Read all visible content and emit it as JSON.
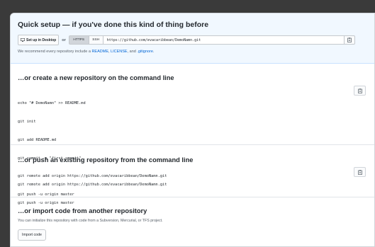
{
  "quick_setup": {
    "title": "Quick setup — if you've done this kind of thing before",
    "desktop_button": "Set up in Desktop",
    "or_label": "or",
    "https_label": "HTTPS",
    "ssh_label": "SSH",
    "clone_url": "https://github.com/evacaribbean/DemoNamn.git",
    "recommend_prefix": "We recommend every repository include a ",
    "readme_link": "README",
    "sep1": ", ",
    "license_link": "LICENSE",
    "sep2": ", and ",
    "gitignore_link": ".gitignore",
    "suffix": "."
  },
  "create_section": {
    "title": "…or create a new repository on the command line",
    "lines": [
      "echo \"# DemoNamn\" >> README.md",
      "git init",
      "git add README.md",
      "git commit -m \"first commit\"",
      "git remote add origin https://github.com/evacaribbean/DemoNamn.git",
      "git push -u origin master"
    ]
  },
  "push_section": {
    "title": "…or push an existing repository from the command line",
    "lines": [
      "git remote add origin https://github.com/evacaribbean/DemoNamn.git",
      "git push -u origin master"
    ]
  },
  "import_section": {
    "title": "…or import code from another repository",
    "description": "You can initialize this repository with code from a Subversion, Mercurial, or TFS project.",
    "button": "Import code"
  },
  "icons": {
    "desktop": "desktop-icon",
    "clipboard": "clipboard-icon"
  }
}
